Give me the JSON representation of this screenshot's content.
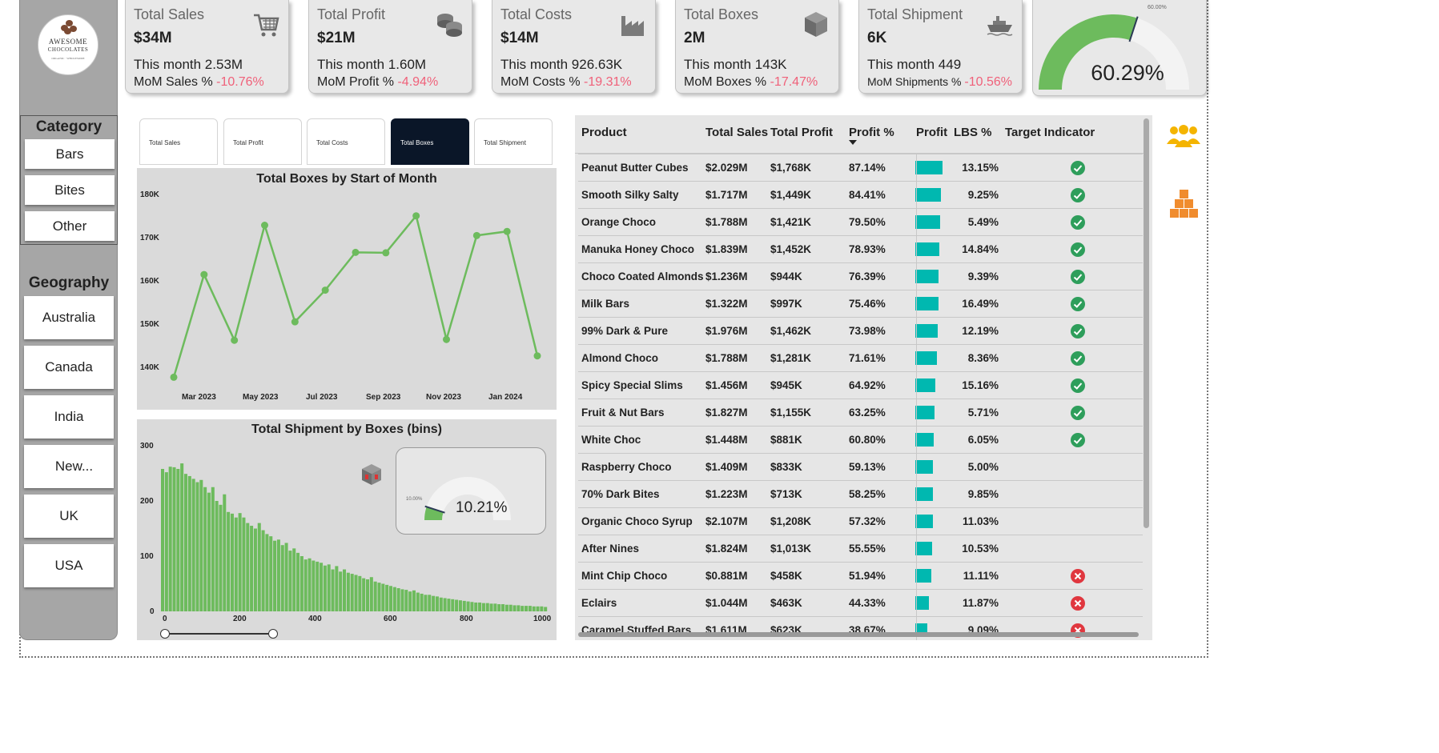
{
  "logo": {
    "line1": "AWESOME",
    "line2": "CHOCOLATES",
    "line3": "ORGANIC · WHOLESOME"
  },
  "filters": {
    "category_title": "Category",
    "category_items": [
      "Bars",
      "Bites",
      "Other"
    ],
    "geography_title": "Geography",
    "geography_items": [
      "Australia",
      "Canada",
      "India",
      "New...",
      "UK",
      "USA"
    ]
  },
  "kpis": [
    {
      "title": "Total Sales",
      "value": "$34M",
      "month": "This month 2.53M",
      "mom_label": "MoM Sales %",
      "mom_value": "-10.76%",
      "icon": "shopping-cart-icon"
    },
    {
      "title": "Total Profit",
      "value": "$21M",
      "month": "This month 1.60M",
      "mom_label": "MoM Profit %",
      "mom_value": "-4.94%",
      "icon": "coins-icon"
    },
    {
      "title": "Total Costs",
      "value": "$14M",
      "month": "This month 926.63K",
      "mom_label": "MoM Costs %",
      "mom_value": "-19.31%",
      "icon": "factory-icon"
    },
    {
      "title": "Total Boxes",
      "value": "2M",
      "month": "This month 143K",
      "mom_label": "MoM Boxes %",
      "mom_value": "-17.47%",
      "icon": "box-icon"
    },
    {
      "title": "Total Shipment",
      "value": "6K",
      "month": "This month 449",
      "mom_label": "MoM Shipments %",
      "mom_value": "-10.56%",
      "icon": "ship-icon"
    }
  ],
  "profit_gauge": {
    "value_label": "60.29%",
    "target_label": "60.00%",
    "value": 0.6029,
    "target": 0.6,
    "color": "#6dbb5d"
  },
  "tabs": [
    "Total Sales",
    "Total Profit",
    "Total Costs",
    "Total Boxes",
    "Total Shipment"
  ],
  "active_tab": "Total Boxes",
  "colors": {
    "accent_green": "#6dbb5d",
    "teal_bar": "#00b8b0",
    "negative": "#f0617a",
    "tab_active": "#0a1628",
    "orange_icon": "#f08c2e",
    "yellow_icon": "#f4b400"
  },
  "line_chart": {
    "title": "Total Boxes by Start of Month",
    "y_ticks": [
      "180K",
      "170K",
      "160K",
      "150K",
      "140K"
    ],
    "x_ticks": [
      "Mar 2023",
      "May 2023",
      "Jul 2023",
      "Sep 2023",
      "Nov 2023",
      "Jan 2024"
    ]
  },
  "hist_chart": {
    "title": "Total Shipment by Boxes (bins)",
    "y_ticks": [
      "300",
      "200",
      "100",
      "0"
    ],
    "x_ticks": [
      "0",
      "200",
      "400",
      "600",
      "800",
      "1000"
    ]
  },
  "boxes_gauge": {
    "value_label": "10.21%",
    "target_label": "10.00%",
    "value": 0.1021,
    "target": 0.1
  },
  "chart_data": [
    {
      "type": "line",
      "title": "Total Boxes by Start of Month",
      "x": [
        "2023-02",
        "2023-03",
        "2023-04",
        "2023-05",
        "2023-06",
        "2023-07",
        "2023-08",
        "2023-09",
        "2023-10",
        "2023-11",
        "2023-12",
        "2024-01",
        "2024-02"
      ],
      "values": [
        137500,
        162500,
        146500,
        174500,
        151000,
        158700,
        167900,
        167800,
        176800,
        146700,
        172000,
        173000,
        142700
      ],
      "ylim": [
        137000,
        182000
      ],
      "color": "#6dbb5d"
    },
    {
      "type": "bar",
      "title": "Total Shipment by Boxes (bins)",
      "bin_width": 10,
      "values": [
        258,
        252,
        262,
        261,
        258,
        268,
        249,
        245,
        240,
        234,
        238,
        225,
        215,
        225,
        200,
        193,
        212,
        180,
        177,
        170,
        178,
        170,
        160,
        155,
        150,
        160,
        147,
        140,
        136,
        128,
        130,
        120,
        124,
        110,
        114,
        106,
        100,
        94,
        96,
        92,
        90,
        88,
        83,
        85,
        76,
        82,
        72,
        76,
        70,
        68,
        66,
        64,
        60,
        58,
        62,
        54,
        52,
        50,
        48,
        46,
        44,
        42,
        40,
        39,
        36,
        38,
        34,
        32,
        30,
        30,
        28,
        27,
        25,
        24,
        23,
        22,
        21,
        20,
        19,
        18,
        17,
        16,
        16,
        15,
        15,
        14,
        14,
        13,
        13,
        12,
        12,
        11,
        11,
        10,
        10,
        10,
        9,
        9,
        9,
        8
      ],
      "ylim": [
        0,
        300
      ],
      "xlim": [
        0,
        1000
      ],
      "color": "#6dbb5d"
    }
  ],
  "table": {
    "headers": {
      "product": "Product",
      "sales": "Total Sales",
      "profit": "Total Profit",
      "profit_pct": "Profit %",
      "profit_bar": "Profit",
      "lbs": "LBS %",
      "target": "Target Indicator"
    },
    "rows": [
      {
        "product": "Peanut Butter Cubes",
        "sales": "$2.029M",
        "profit": "$1,768K",
        "profit_pct": "87.14%",
        "lbs": "13.15%",
        "bar": 1.0,
        "status": "ok"
      },
      {
        "product": "Smooth Silky Salty",
        "sales": "$1.717M",
        "profit": "$1,449K",
        "profit_pct": "84.41%",
        "lbs": "9.25%",
        "bar": 0.95,
        "status": "ok"
      },
      {
        "product": "Orange Choco",
        "sales": "$1.788M",
        "profit": "$1,421K",
        "profit_pct": "79.50%",
        "lbs": "5.49%",
        "bar": 0.9,
        "status": "ok"
      },
      {
        "product": "Manuka Honey Choco",
        "sales": "$1.839M",
        "profit": "$1,452K",
        "profit_pct": "78.93%",
        "lbs": "14.84%",
        "bar": 0.89,
        "status": "ok"
      },
      {
        "product": "Choco Coated Almonds",
        "sales": "$1.236M",
        "profit": "$944K",
        "profit_pct": "76.39%",
        "lbs": "9.39%",
        "bar": 0.86,
        "status": "ok"
      },
      {
        "product": "Milk Bars",
        "sales": "$1.322M",
        "profit": "$997K",
        "profit_pct": "75.46%",
        "lbs": "16.49%",
        "bar": 0.85,
        "status": "ok"
      },
      {
        "product": "99% Dark & Pure",
        "sales": "$1.976M",
        "profit": "$1,462K",
        "profit_pct": "73.98%",
        "lbs": "12.19%",
        "bar": 0.83,
        "status": "ok"
      },
      {
        "product": "Almond Choco",
        "sales": "$1.788M",
        "profit": "$1,281K",
        "profit_pct": "71.61%",
        "lbs": "8.36%",
        "bar": 0.8,
        "status": "ok"
      },
      {
        "product": "Spicy Special Slims",
        "sales": "$1.456M",
        "profit": "$945K",
        "profit_pct": "64.92%",
        "lbs": "15.16%",
        "bar": 0.73,
        "status": "ok"
      },
      {
        "product": "Fruit & Nut Bars",
        "sales": "$1.827M",
        "profit": "$1,155K",
        "profit_pct": "63.25%",
        "lbs": "5.71%",
        "bar": 0.71,
        "status": "ok"
      },
      {
        "product": "White Choc",
        "sales": "$1.448M",
        "profit": "$881K",
        "profit_pct": "60.80%",
        "lbs": "6.05%",
        "bar": 0.68,
        "status": "ok"
      },
      {
        "product": "Raspberry Choco",
        "sales": "$1.409M",
        "profit": "$833K",
        "profit_pct": "59.13%",
        "lbs": "5.00%",
        "bar": 0.66,
        "status": "none"
      },
      {
        "product": "70% Dark Bites",
        "sales": "$1.223M",
        "profit": "$713K",
        "profit_pct": "58.25%",
        "lbs": "9.85%",
        "bar": 0.65,
        "status": "none"
      },
      {
        "product": "Organic Choco Syrup",
        "sales": "$2.107M",
        "profit": "$1,208K",
        "profit_pct": "57.32%",
        "lbs": "11.03%",
        "bar": 0.64,
        "status": "none"
      },
      {
        "product": "After Nines",
        "sales": "$1.824M",
        "profit": "$1,013K",
        "profit_pct": "55.55%",
        "lbs": "10.53%",
        "bar": 0.62,
        "status": "none"
      },
      {
        "product": "Mint Chip Choco",
        "sales": "$0.881M",
        "profit": "$458K",
        "profit_pct": "51.94%",
        "lbs": "11.11%",
        "bar": 0.58,
        "status": "bad"
      },
      {
        "product": "Eclairs",
        "sales": "$1.044M",
        "profit": "$463K",
        "profit_pct": "44.33%",
        "lbs": "11.87%",
        "bar": 0.5,
        "status": "bad"
      },
      {
        "product": "Caramel Stuffed Bars",
        "sales": "$1.611M",
        "profit": "$623K",
        "profit_pct": "38.67%",
        "lbs": "9.09%",
        "bar": 0.44,
        "status": "bad"
      }
    ]
  },
  "right_icons": [
    "people-icon",
    "boxes-stack-icon"
  ]
}
